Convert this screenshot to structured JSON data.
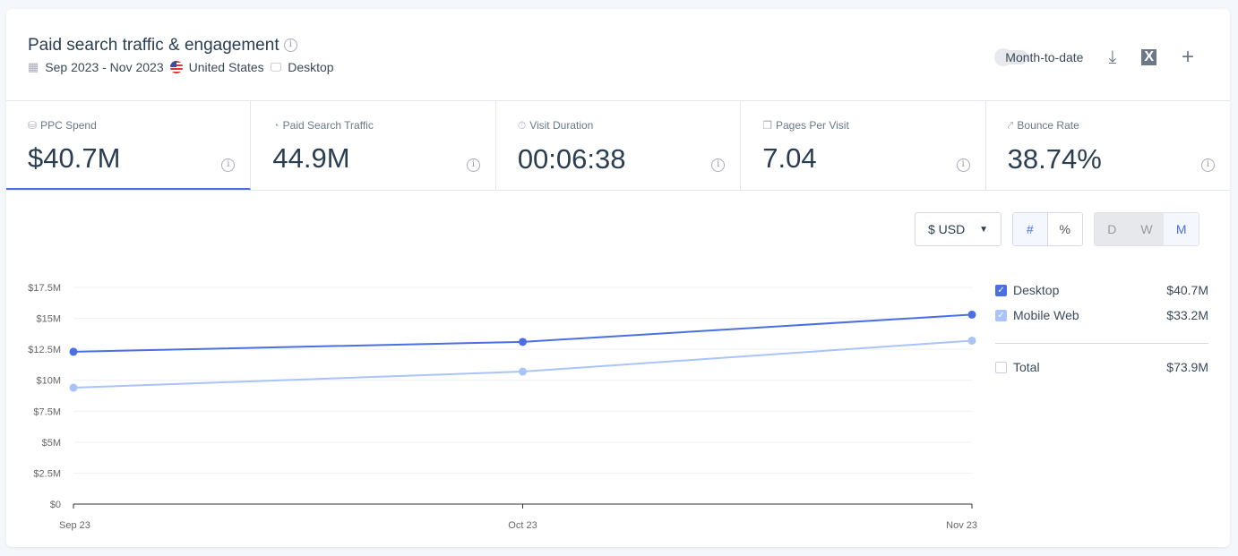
{
  "header": {
    "title": "Paid search traffic & engagement",
    "date_range": "Sep 2023 - Nov 2023",
    "country": "United States",
    "device": "Desktop",
    "month_to_date_label": "Month-to-date",
    "month_to_date_on": false
  },
  "kpis": [
    {
      "label": "PPC Spend",
      "value": "$40.7M",
      "icon": "coins-icon",
      "active": true
    },
    {
      "label": "Paid Search Traffic",
      "value": "44.9M",
      "icon": "pie-icon"
    },
    {
      "label": "Visit Duration",
      "value": "00:06:38",
      "icon": "stopwatch-icon"
    },
    {
      "label": "Pages Per Visit",
      "value": "7.04",
      "icon": "pages-icon"
    },
    {
      "label": "Bounce Rate",
      "value": "38.74%",
      "icon": "bounce-icon"
    }
  ],
  "controls": {
    "currency": "$ USD",
    "number_mode": [
      "#",
      "%"
    ],
    "granularity": [
      "D",
      "W",
      "M"
    ],
    "selected_granularity": "M",
    "selected_mode": "#"
  },
  "legend": {
    "items": [
      {
        "label": "Desktop",
        "value": "$40.7M",
        "checked": true,
        "color": "#4a6fe3"
      },
      {
        "label": "Mobile Web",
        "value": "$33.2M",
        "checked": true,
        "color": "#a9c3fb"
      }
    ],
    "total": {
      "label": "Total",
      "value": "$73.9M",
      "checked": false
    }
  },
  "chart_data": {
    "type": "line",
    "x": [
      "Sep 23",
      "Oct 23",
      "Nov 23"
    ],
    "yticks": [
      "$0",
      "$2.5M",
      "$5M",
      "$7.5M",
      "$10M",
      "$12.5M",
      "$15M",
      "$17.5M"
    ],
    "ylim": [
      0,
      17.5
    ],
    "grid": true,
    "series": [
      {
        "name": "Desktop",
        "color": "#4a6fe3",
        "values": [
          12.3,
          13.1,
          15.3
        ]
      },
      {
        "name": "Mobile Web",
        "color": "#a9c3fb",
        "values": [
          9.4,
          10.7,
          13.2
        ]
      }
    ]
  }
}
